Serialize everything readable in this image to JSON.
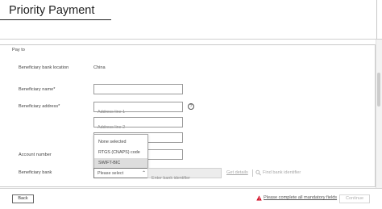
{
  "page": {
    "title": "Priority Payment"
  },
  "section": {
    "heading": "Pay to"
  },
  "form": {
    "bank_location": {
      "label": "Beneficiary bank location",
      "value": "China"
    },
    "name": {
      "label": "Beneficiary name*",
      "value": "",
      "placeholder": ""
    },
    "address": {
      "label": "Beneficiary address*",
      "line1_placeholder": "Address line 1",
      "line2_placeholder": "Address line 2",
      "line3_placeholder": ""
    },
    "account_number": {
      "label": "Account number",
      "placeholder": ""
    },
    "beneficiary_bank": {
      "label": "Beneficiary bank",
      "select_value": "Please select",
      "options": [
        "None selected",
        "RTGS (CNAPS) code",
        "SWIFT-BIC"
      ],
      "highlighted_option": "SWIFT-BIC",
      "identifier_placeholder": "Enter bank identifier",
      "get_details_label": "Get details",
      "find_bank_label": "Find bank identifier"
    }
  },
  "icons": {
    "help": "help-circle-icon",
    "caret": "chevron-down-icon",
    "search": "search-icon",
    "warning": "warning-triangle-icon"
  },
  "footer": {
    "back_label": "Back",
    "warning_text": "Please complete all mandatory fields",
    "continue_label": "Continue"
  },
  "colors": {
    "warning": "#d0021b",
    "disabled": "#b0b0b0"
  }
}
